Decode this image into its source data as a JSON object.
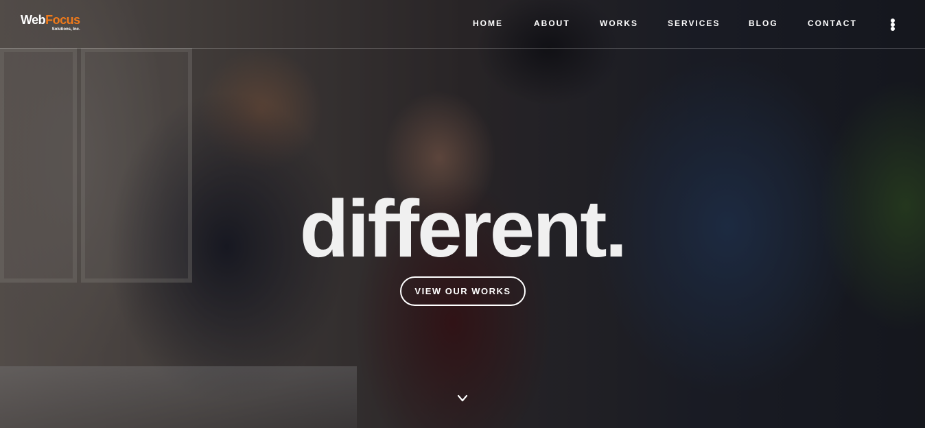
{
  "logo": {
    "word_1": "Web",
    "word_2": "Focus",
    "subtitle": "Solutions, Inc.",
    "accent_color": "#f07a1a"
  },
  "nav": {
    "items": [
      {
        "label": "HOME"
      },
      {
        "label": "ABOUT"
      },
      {
        "label": "WORKS"
      },
      {
        "label": "SERVICES"
      },
      {
        "label": "BLOG"
      },
      {
        "label": "CONTACT"
      }
    ],
    "more_icon": "vertical-ellipsis-icon"
  },
  "hero": {
    "headline": "different.",
    "cta_label": "VIEW OUR WORKS",
    "scroll_icon": "chevron-down-icon"
  }
}
